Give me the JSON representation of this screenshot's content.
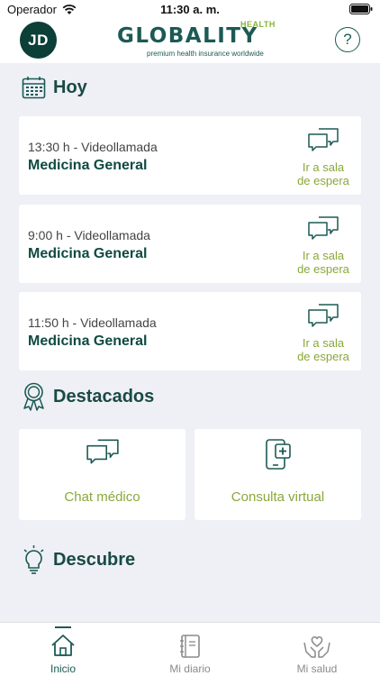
{
  "status_bar": {
    "carrier": "Operador",
    "time": "11:30 a. m."
  },
  "header": {
    "avatar_initials": "JD",
    "logo_text": "GLOBALITY",
    "logo_health": "HEALTH",
    "logo_tagline": "premium health insurance worldwide",
    "help_label": "?"
  },
  "today": {
    "title": "Hoy",
    "appointments": [
      {
        "time": "13:30 h - Videollamada",
        "specialty": "Medicina General",
        "action_line1": "Ir a sala",
        "action_line2": "de espera"
      },
      {
        "time": "9:00 h - Videollamada",
        "specialty": "Medicina General",
        "action_line1": "Ir a sala",
        "action_line2": "de espera"
      },
      {
        "time": "11:50 h - Videollamada",
        "specialty": "Medicina General",
        "action_line1": "Ir a sala",
        "action_line2": "de espera"
      }
    ]
  },
  "featured": {
    "title": "Destacados",
    "tiles": [
      {
        "label": "Chat médico",
        "icon": "chat-bubbles-icon"
      },
      {
        "label": "Consulta virtual",
        "icon": "phone-medical-icon"
      }
    ]
  },
  "discover": {
    "title": "Descubre"
  },
  "tabbar": {
    "tabs": [
      {
        "label": "Inicio",
        "icon": "home-icon",
        "active": true
      },
      {
        "label": "Mi diario",
        "icon": "notebook-icon",
        "active": false
      },
      {
        "label": "Mi salud",
        "icon": "hands-heart-icon",
        "active": false
      }
    ]
  },
  "colors": {
    "primary": "#1c5a54",
    "accent": "#8aa83a",
    "background": "#eef0f6",
    "avatar_bg": "#0b3f38"
  }
}
